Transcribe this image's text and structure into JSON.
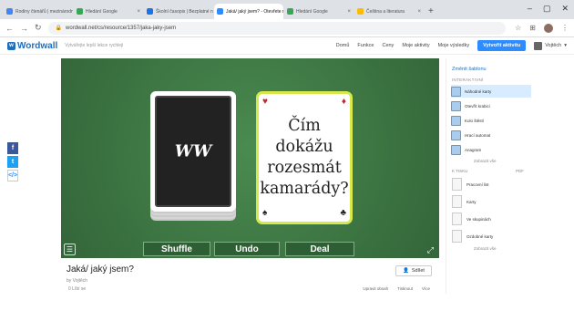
{
  "browser": {
    "tabs": [
      {
        "label": "Rodiny čtenářů | mezinárodní den",
        "active": false,
        "color": "#4285f4"
      },
      {
        "label": "Hledání Google",
        "active": false,
        "color": "#34a853"
      },
      {
        "label": "Školní časopis | Bezplatné nápady",
        "active": false,
        "color": "#1a73e8"
      },
      {
        "label": "Jaká/ jaký jsem? - Otevřete rám",
        "active": true,
        "color": "#2d8cff"
      },
      {
        "label": "Hledání Google",
        "active": false,
        "color": "#34a853"
      },
      {
        "label": "Čeština a literatura",
        "active": false,
        "color": "#fbbc04"
      }
    ],
    "new_tab": "+",
    "url": "wordwall.net/cs/resource/1357/jaka-jaky-jsem"
  },
  "header": {
    "logo": "Wordwall",
    "tagline": "Vytvářejte lepší lekce rychleji",
    "menu": [
      "Domů",
      "Funkce",
      "Ceny",
      "Moje aktivity",
      "Moje výsledky"
    ],
    "create_label": "Vytvořit aktivitu",
    "user_label": "Vojtěch"
  },
  "game": {
    "emblem": "WW",
    "card_text": "Čím dokážu rozesmát kamarády?",
    "buttons": {
      "shuffle": "Shuffle",
      "undo": "Undo",
      "deal": "Deal"
    }
  },
  "share_icons": [
    "f",
    "t",
    "</>"
  ],
  "info": {
    "title": "Jaká/ jaký jsem?",
    "author": "by Vojtěch",
    "likes": "0 Líbí se",
    "share_label": "Sdílet",
    "options": [
      "Upravit obsah",
      "Tisknout",
      "Více"
    ]
  },
  "sidebar": {
    "switch_template": "Změnit šablonu",
    "interactives": "INTERAKTIVNÍ",
    "items": [
      {
        "label": "Náhodné karty",
        "selected": true
      },
      {
        "label": "Otevřít krabici",
        "selected": false
      },
      {
        "label": "Kolo štěstí",
        "selected": false
      },
      {
        "label": "Hrací automat",
        "selected": false
      },
      {
        "label": "Anagram",
        "selected": false
      }
    ],
    "show_all": "Zobrazit vše",
    "printables": "K TISKU",
    "pdf": "PDF",
    "templates": [
      "Pracovní list",
      "Karty",
      "Ve skupinách",
      "Ozdobné karty"
    ],
    "show_all_2": "Zobrazit vše"
  }
}
